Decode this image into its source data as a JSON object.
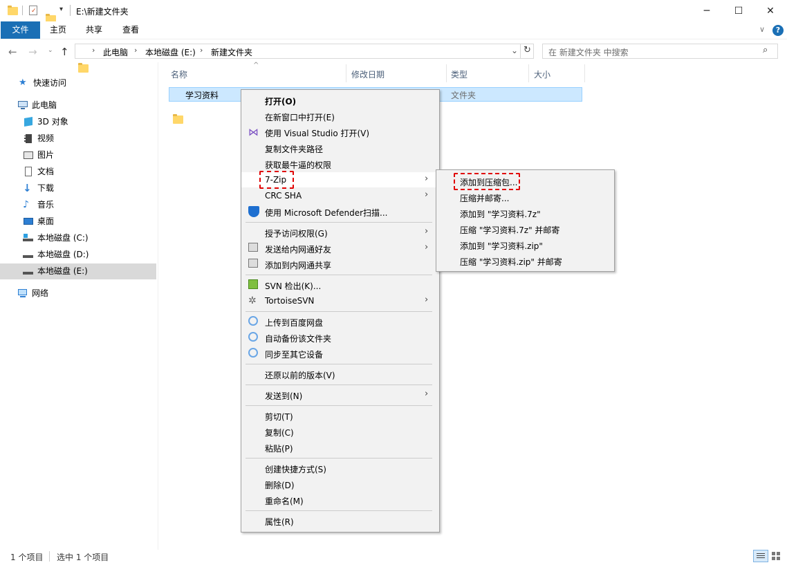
{
  "window": {
    "title": "E:\\新建文件夹",
    "minimize": "─",
    "maximize": "☐",
    "close": "✕"
  },
  "ribbon": {
    "tabs": [
      "文件",
      "主页",
      "共享",
      "查看"
    ],
    "expand": "∨",
    "help": "?"
  },
  "address": {
    "crumbs": [
      "此电脑",
      "本地磁盘 (E:)",
      "新建文件夹"
    ],
    "search_placeholder": "在 新建文件夹 中搜索"
  },
  "nav": {
    "quick_access": "快速访问",
    "this_pc": "此电脑",
    "items": [
      "3D 对象",
      "视频",
      "图片",
      "文档",
      "下载",
      "音乐",
      "桌面",
      "本地磁盘 (C:)",
      "本地磁盘 (D:)",
      "本地磁盘 (E:)"
    ],
    "network": "网络"
  },
  "columns": [
    "名称",
    "修改日期",
    "类型",
    "大小"
  ],
  "files": [
    {
      "name": "学习资料",
      "type": "文件夹"
    }
  ],
  "context_menu": {
    "items": [
      "打开(O)",
      "在新窗口中打开(E)",
      "使用 Visual Studio 打开(V)",
      "复制文件夹路径",
      "获取最牛逼的权限",
      "7-Zip",
      "CRC SHA",
      "使用 Microsoft Defender扫描...",
      "授予访问权限(G)",
      "发送给内网通好友",
      "添加到内网通共享",
      "SVN 检出(K)...",
      "TortoiseSVN",
      "上传到百度网盘",
      "自动备份该文件夹",
      "同步至其它设备",
      "还原以前的版本(V)",
      "发送到(N)",
      "剪切(T)",
      "复制(C)",
      "粘贴(P)",
      "创建快捷方式(S)",
      "删除(D)",
      "重命名(M)",
      "属性(R)"
    ]
  },
  "submenu": {
    "items": [
      "添加到压缩包...",
      "压缩并邮寄...",
      "添加到 \"学习资料.7z\"",
      "压缩 \"学习资料.7z\" 并邮寄",
      "添加到 \"学习资料.zip\"",
      "压缩 \"学习资料.zip\" 并邮寄"
    ]
  },
  "status": {
    "count": "1 个项目",
    "selected": "选中 1 个项目"
  },
  "colors": {
    "accent": "#1a6fb5",
    "selection": "#cce8ff",
    "highlight_red": "#e00000"
  }
}
